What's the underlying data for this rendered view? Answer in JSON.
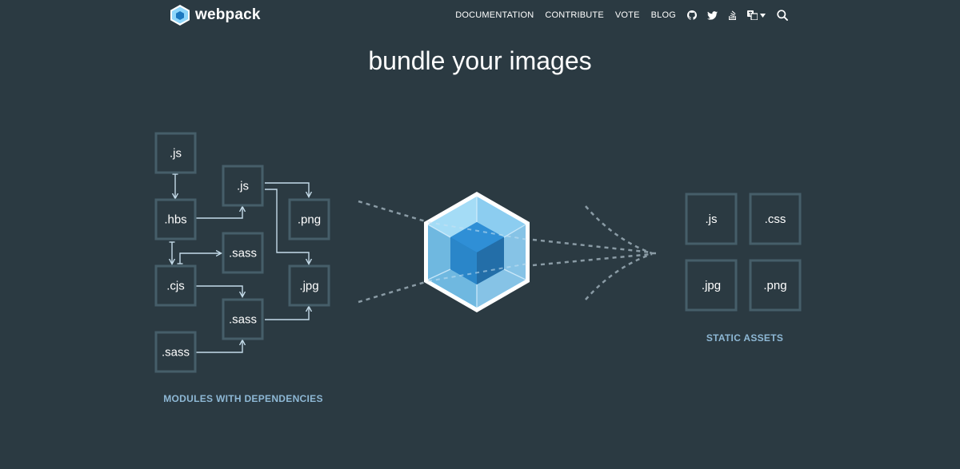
{
  "header": {
    "logo_text": "webpack",
    "nav": [
      {
        "id": "documentation",
        "label": "DOCUMENTATION"
      },
      {
        "id": "contribute",
        "label": "CONTRIBUTE"
      },
      {
        "id": "vote",
        "label": "VOTE"
      },
      {
        "id": "blog",
        "label": "BLOG"
      }
    ],
    "icons": [
      "github-icon",
      "twitter-icon",
      "stackoverflow-icon",
      "language-icon",
      "search-icon"
    ]
  },
  "hero": {
    "title": "bundle your images",
    "modules_caption": "MODULES WITH DEPENDENCIES",
    "assets_caption": "STATIC ASSETS",
    "modules": [
      ".js",
      ".js",
      ".hbs",
      ".png",
      ".sass",
      ".cjs",
      ".jpg",
      ".sass",
      ".sass"
    ],
    "assets": [
      ".js",
      ".css",
      ".jpg",
      ".png"
    ]
  },
  "colors": {
    "background": "#2b3a42",
    "box_border": "#465e69",
    "arrow": "#c4dbe9",
    "caption": "#8eb8d5",
    "cube_light": "#8ed6fb",
    "cube_dark": "#1c78c0"
  }
}
